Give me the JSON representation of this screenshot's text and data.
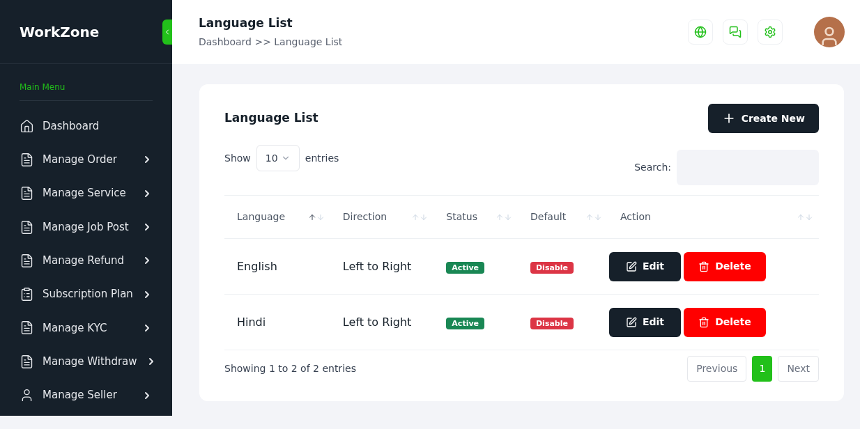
{
  "sidebar": {
    "brand": "WorkZone",
    "section": "Main Menu",
    "items": [
      {
        "label": "Dashboard",
        "kind": "home",
        "has_submenu": false
      },
      {
        "label": "Manage Order",
        "kind": "doc",
        "has_submenu": true
      },
      {
        "label": "Manage Service",
        "kind": "doc",
        "has_submenu": true
      },
      {
        "label": "Manage Job Post",
        "kind": "doc",
        "has_submenu": true
      },
      {
        "label": "Manage Refund",
        "kind": "doc",
        "has_submenu": true
      },
      {
        "label": "Subscription Plan",
        "kind": "clipboard",
        "has_submenu": true
      },
      {
        "label": "Manage KYC",
        "kind": "doc",
        "has_submenu": true
      },
      {
        "label": "Manage Withdraw",
        "kind": "doc",
        "has_submenu": true
      },
      {
        "label": "Manage Seller",
        "kind": "user",
        "has_submenu": true
      }
    ]
  },
  "header": {
    "title": "Language List",
    "breadcrumb": "Dashboard >> Language List"
  },
  "card": {
    "title": "Language List",
    "create_button": "Create New",
    "show_label": "Show",
    "entries_value": "10",
    "entries_label": "entries",
    "search_label": "Search:",
    "table": {
      "columns": [
        {
          "label": "Language",
          "sorted": true
        },
        {
          "label": "Direction",
          "sorted": false
        },
        {
          "label": "Status",
          "sorted": false
        },
        {
          "label": "Default",
          "sorted": false
        },
        {
          "label": "Action",
          "sorted": false
        }
      ],
      "rows": [
        {
          "language": "English",
          "direction": "Left to Right",
          "status": {
            "label": "Active",
            "kind": "success"
          },
          "default": {
            "label": "Disable",
            "kind": "danger"
          },
          "edit": "Edit",
          "delete": "Delete"
        },
        {
          "language": "Hindi",
          "direction": "Left to Right",
          "status": {
            "label": "Active",
            "kind": "success"
          },
          "default": {
            "label": "Disable",
            "kind": "danger"
          },
          "edit": "Edit",
          "delete": "Delete"
        }
      ]
    },
    "info": "Showing 1 to 2 of 2 entries",
    "pagination": {
      "previous": "Previous",
      "pages": [
        {
          "label": "1",
          "selected": true
        }
      ],
      "next": "Next"
    }
  }
}
